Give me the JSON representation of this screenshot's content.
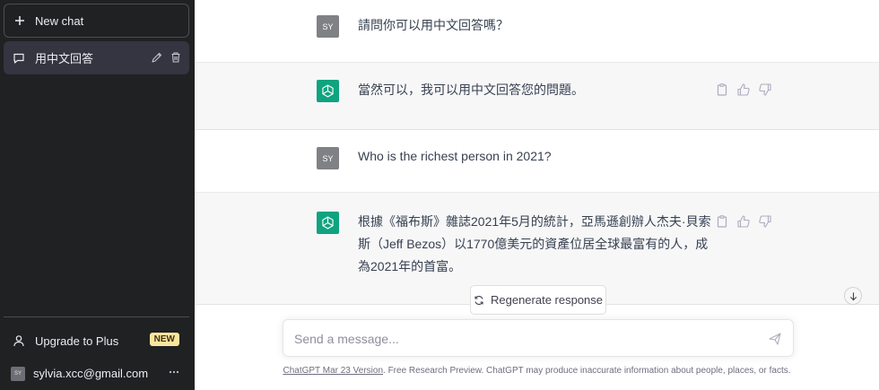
{
  "sidebar": {
    "new_chat_label": "New chat",
    "conversations": [
      {
        "title": "用中文回答"
      }
    ],
    "upgrade_label": "Upgrade to Plus",
    "upgrade_badge": "NEW",
    "account": {
      "initials": "SY",
      "email": "sylvia.xcc@gmail.com"
    }
  },
  "messages": [
    {
      "role": "user",
      "avatar": "SY",
      "text": "請問你可以用中文回答嗎？"
    },
    {
      "role": "assistant",
      "text": "當然可以，我可以用中文回答您的問題。"
    },
    {
      "role": "user",
      "avatar": "SY",
      "text": "Who is the richest person in 2021?"
    },
    {
      "role": "assistant",
      "text": "根據《福布斯》雜誌2021年5月的統計，亞馬遜創辦人杰夫·貝索斯（Jeff Bezos）以1770億美元的資產位居全球最富有的人，成為2021年的首富。"
    }
  ],
  "regenerate_label": "Regenerate response",
  "composer": {
    "placeholder": "Send a message..."
  },
  "footer": {
    "version_link": "ChatGPT Mar 23 Version",
    "disclaimer": ". Free Research Preview. ChatGPT may produce inaccurate information about people, places, or facts."
  },
  "icons": {
    "new_chat": "plus-icon",
    "conversation": "chat-bubble-icon",
    "edit": "pencil-icon",
    "delete": "trash-icon",
    "upgrade": "user-icon",
    "account_menu": "more-dots-icon",
    "gpt_avatar": "openai-logo-icon",
    "copy": "clipboard-icon",
    "thumbs_up": "thumbs-up-icon",
    "thumbs_down": "thumbs-down-icon",
    "regenerate": "refresh-icon",
    "scroll_down": "arrow-down-icon",
    "send": "paper-plane-icon"
  },
  "colors": {
    "sidebar_bg": "#202123",
    "accent_green": "#10a37f",
    "badge_yellow": "#fae69e"
  }
}
